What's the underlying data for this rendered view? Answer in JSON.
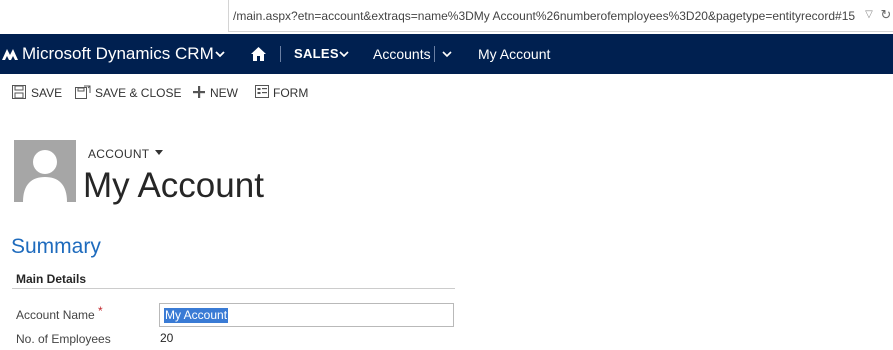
{
  "browser": {
    "url": "/main.aspx?etn=account&extraqs=name%3DMy Account%26numberofemployees%3D20&pagetype=entityrecord#15",
    "dropdown_glyph": "▽",
    "refresh_glyph": "↻"
  },
  "navbar": {
    "brand": "Microsoft Dynamics CRM",
    "area": "SALES",
    "entity": "Accounts",
    "record": "My Account"
  },
  "commands": {
    "save": "SAVE",
    "save_close": "SAVE & CLOSE",
    "new": "NEW",
    "form": "FORM"
  },
  "header": {
    "entity_type": "ACCOUNT",
    "record_title": "My Account"
  },
  "form": {
    "section_title": "Summary",
    "tab_heading": "Main Details",
    "fields": [
      {
        "label": "Account Name",
        "required_marker": "*",
        "value": "My Account"
      },
      {
        "label": "No. of Employees",
        "value": "20"
      }
    ]
  },
  "colors": {
    "navbar_bg": "#002050",
    "section_title": "#1e6bbd",
    "required": "#c1272d",
    "selection": "#3a7bd5"
  },
  "icons": [
    "dynamics-logo-icon",
    "chevron-down-icon",
    "home-icon",
    "save-icon",
    "save-close-icon",
    "plus-icon",
    "form-icon",
    "avatar-placeholder-icon",
    "caret-down-icon"
  ]
}
